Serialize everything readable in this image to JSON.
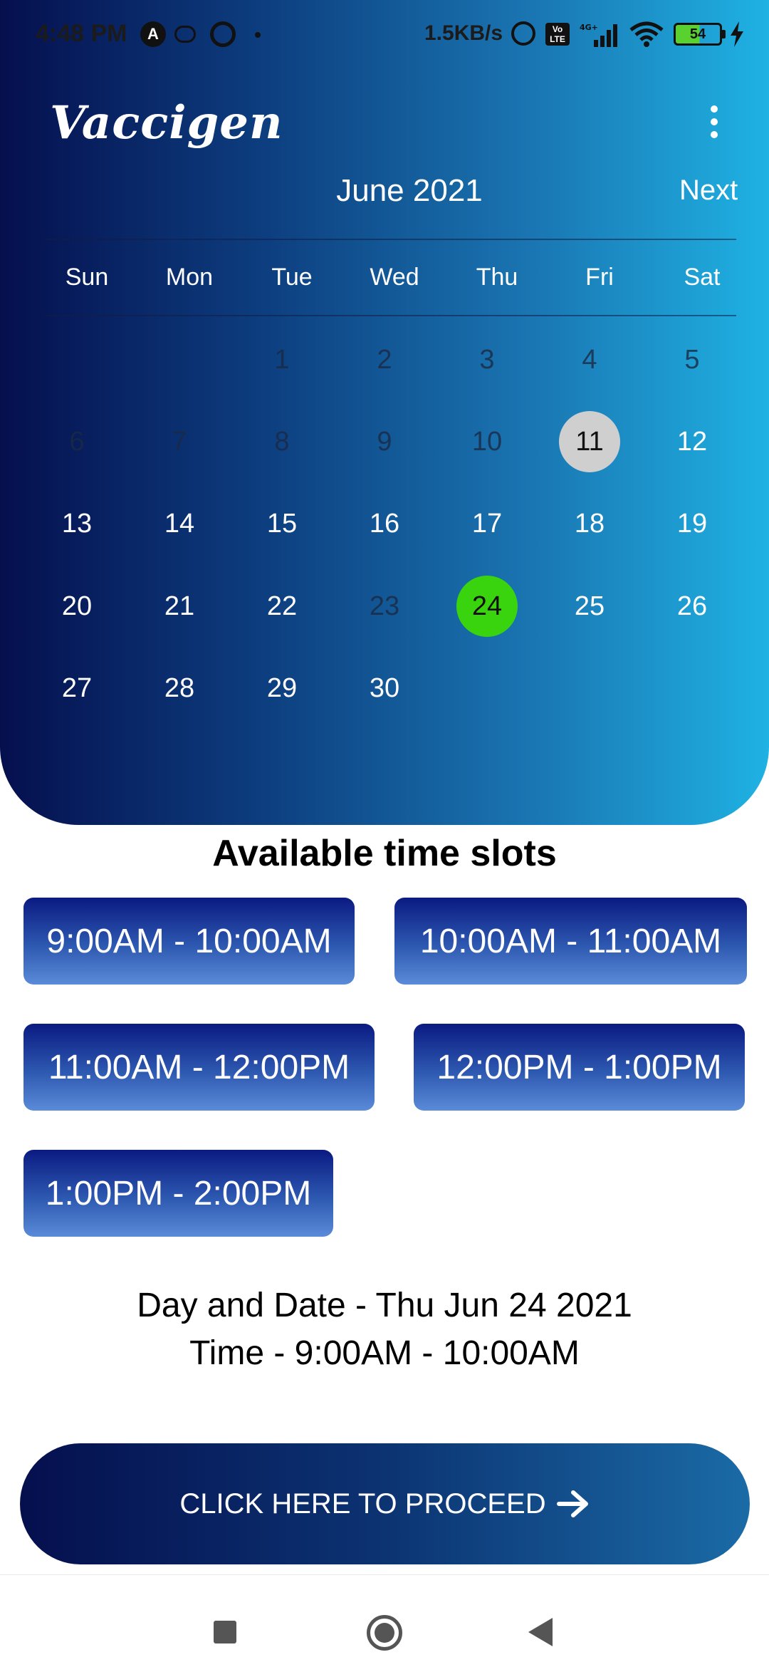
{
  "status_bar": {
    "time": "4:48 PM",
    "speed": "1.5KB/s",
    "volte": "Vo LTE",
    "battery": "54"
  },
  "app": {
    "title": "Vaccigen"
  },
  "calendar": {
    "month_title": "June 2021",
    "next_label": "Next",
    "weekdays": [
      "Sun",
      "Mon",
      "Tue",
      "Wed",
      "Thu",
      "Fri",
      "Sat"
    ],
    "today": "11",
    "selected": "24",
    "weeks": [
      [
        "",
        "",
        "1",
        "2",
        "3",
        "4",
        "5"
      ],
      [
        "6",
        "7",
        "8",
        "9",
        "10",
        "11",
        "12"
      ],
      [
        "13",
        "14",
        "15",
        "16",
        "17",
        "18",
        "19"
      ],
      [
        "20",
        "21",
        "22",
        "23",
        "24",
        "25",
        "26"
      ],
      [
        "27",
        "28",
        "29",
        "30",
        "",
        "",
        ""
      ]
    ],
    "selected_color": "#3ad40e",
    "today_color": "#cfcfcf"
  },
  "slots": {
    "heading": "Available time slots",
    "items": [
      "9:00AM - 10:00AM",
      "10:00AM - 11:00AM",
      "11:00AM - 12:00PM",
      "12:00PM - 1:00PM",
      "1:00PM - 2:00PM"
    ]
  },
  "summary": {
    "date_line": "Day and Date - Thu Jun 24 2021",
    "time_line": "Time - 9:00AM - 10:00AM"
  },
  "proceed": {
    "label": "CLICK HERE TO PROCEED"
  },
  "nav": {
    "icons": [
      "recents-icon",
      "home-icon",
      "back-icon"
    ]
  }
}
